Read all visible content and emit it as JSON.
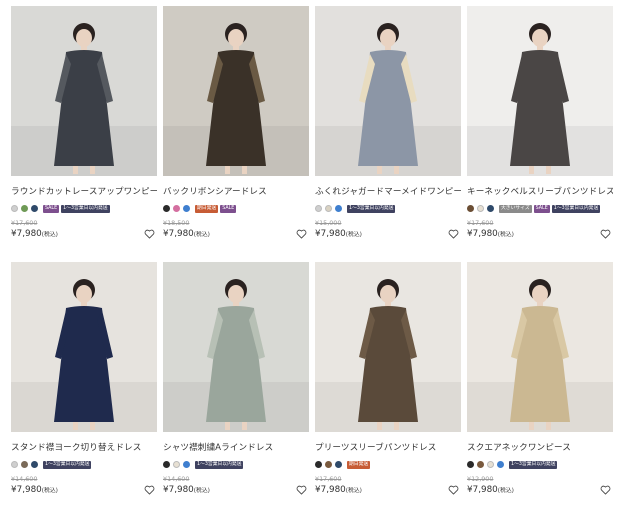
{
  "products": [
    {
      "title": "ラウンドカットレースアップワンピース",
      "colors": [
        "#cfcfcf",
        "#6f9a56",
        "#2f4a6a"
      ],
      "badges": [
        {
          "type": "sale",
          "text": "SALE"
        },
        {
          "type": "ship",
          "text": "1〜3営業日以内発送"
        }
      ],
      "old_price": "¥17,600",
      "price": "¥7,980",
      "tax": "(税込)",
      "photo": {
        "bg": "#d9d9d6",
        "garment": "#3b3f47",
        "accent": "#55595f"
      }
    },
    {
      "title": "バックリボンシアードレス",
      "colors": [
        "#2a2a2a",
        "#d46fa0",
        "#3f7fcf"
      ],
      "badges": [
        {
          "type": "timed",
          "text": "期日発送"
        },
        {
          "type": "sale",
          "text": "SALE"
        }
      ],
      "old_price": "¥18,500",
      "price": "¥7,980",
      "tax": "(税込)",
      "photo": {
        "bg": "#cfcbc3",
        "garment": "#3a3128",
        "accent": "#6a5a44"
      }
    },
    {
      "title": "ふくれジャガードマーメイドワンピース",
      "colors": [
        "#cfcfcf",
        "#d9d2c2",
        "#3f7fcf"
      ],
      "badges": [
        {
          "type": "ship",
          "text": "1〜3営業日以内発送"
        }
      ],
      "old_price": "¥15,000",
      "price": "¥7,980",
      "tax": "(税込)",
      "photo": {
        "bg": "#e2e0dd",
        "garment": "#8c96a6",
        "accent": "#e8dcc0"
      }
    },
    {
      "title": "キーネックベルスリーブパンツドレス",
      "colors": [
        "#6b4e34",
        "#e7e0d3",
        "#2f4a6a"
      ],
      "badges": [
        {
          "type": "size",
          "text": "大きいサイズ"
        },
        {
          "type": "sale",
          "text": "SALE"
        },
        {
          "type": "ship",
          "text": "1〜3営業日以内発送"
        }
      ],
      "old_price": "¥17,600",
      "price": "¥7,980",
      "tax": "(税込)",
      "photo": {
        "bg": "#efeeec",
        "garment": "#4a4645",
        "accent": "#4a4645"
      }
    },
    {
      "title": "スタンド襟ヨーク切り替えドレス",
      "colors": [
        "#cfcfcf",
        "#7a6a58",
        "#2f4a6a"
      ],
      "badges": [
        {
          "type": "ship",
          "text": "1〜3営業日以内発送"
        }
      ],
      "old_price": "¥14,600",
      "price": "¥7,980",
      "tax": "(税込)",
      "photo": {
        "bg": "#e6e3de",
        "garment": "#1f2a4d",
        "accent": "#1f2a4d"
      }
    },
    {
      "title": "シャツ襟刺繍Aラインドレス",
      "colors": [
        "#2a2a2a",
        "#e7e0d3",
        "#3f7fcf"
      ],
      "badges": [
        {
          "type": "ship",
          "text": "1〜3営業日以内発送"
        }
      ],
      "old_price": "¥14,600",
      "price": "¥7,980",
      "tax": "(税込)",
      "photo": {
        "bg": "#d8d9d4",
        "garment": "#9aa69c",
        "accent": "#b7c0b5"
      }
    },
    {
      "title": "プリーツスリーブパンツドレス",
      "colors": [
        "#2a2a2a",
        "#7a5a3e",
        "#2f4a6a"
      ],
      "badges": [
        {
          "type": "timed",
          "text": "期日発送"
        }
      ],
      "old_price": "¥17,600",
      "price": "¥7,980",
      "tax": "(税込)",
      "photo": {
        "bg": "#e9e6e1",
        "garment": "#5a4a3a",
        "accent": "#6d5a46"
      }
    },
    {
      "title": "スクエアネックワンピース",
      "colors": [
        "#2a2a2a",
        "#7a5a3e",
        "#e7e0d3",
        "#3f7fcf"
      ],
      "badges": [
        {
          "type": "ship",
          "text": "1〜3営業日以内発送"
        }
      ],
      "old_price": "¥12,900",
      "price": "¥7,980",
      "tax": "(税込)",
      "photo": {
        "bg": "#ebe7e1",
        "garment": "#cbb892",
        "accent": "#d9c8a4"
      }
    }
  ]
}
